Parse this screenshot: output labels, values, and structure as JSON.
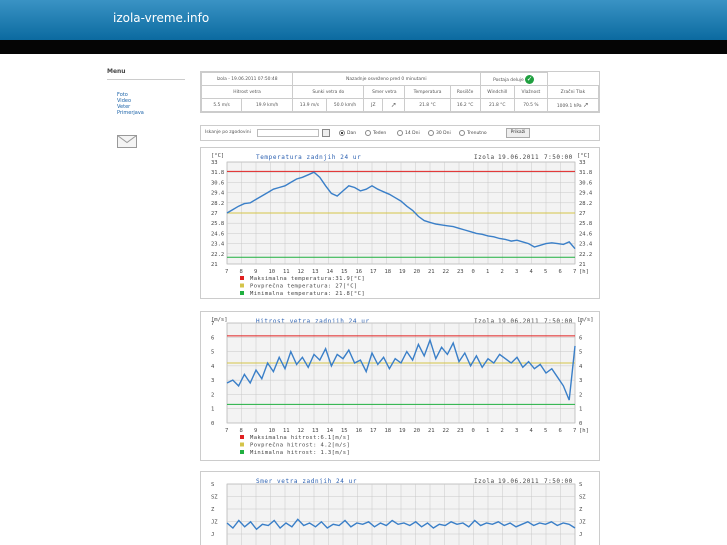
{
  "header": {
    "title": "izola-vreme.info"
  },
  "sidebar": {
    "menu_title": "Menu",
    "links": [
      "Foto",
      "Video",
      "Veter",
      "Primerjava"
    ]
  },
  "status": {
    "location_time": "Izola - 19.06.2011 07:50:48",
    "updated": "Nazadnje osveženo pred 0 minutami",
    "station_status": "Postaja deluje"
  },
  "table": {
    "headers": [
      "Hitrost vetra",
      "Sunki vetra do",
      "Smer vetra",
      "Temperatura",
      "Rosišče",
      "Windchill",
      "Vlažnost",
      "Zračni Tlak"
    ],
    "values": [
      "5.5 m/s",
      "19.9 km/h",
      "13.9 m/s",
      "50.0 km/h",
      "JZ",
      "21.8 °C",
      "16.2 °C",
      "21.8 °C",
      "70.5 %",
      "1009.1 hPa"
    ]
  },
  "search": {
    "label": "Iskanje po zgodovini",
    "radios": [
      "Dan",
      "Teden",
      "14 Dni",
      "30 Dni",
      "Trenutno"
    ],
    "selected": "Dan",
    "button": "Prikaži"
  },
  "chart_data": [
    {
      "type": "line",
      "title": "Temperatura zadnjih 24 ur",
      "station": "Izola",
      "date": "19.06.2011",
      "time": "7:50:00",
      "unit": "[°C]",
      "x_unit": "[h]",
      "x_ticks": [
        "7",
        "8",
        "9",
        "10",
        "11",
        "12",
        "13",
        "14",
        "15",
        "16",
        "17",
        "18",
        "19",
        "20",
        "21",
        "22",
        "23",
        "0",
        "1",
        "2",
        "3",
        "4",
        "5",
        "6",
        "7"
      ],
      "ylim": [
        21,
        33
      ],
      "y_ticks": [
        "21",
        "22.2",
        "23.4",
        "24.6",
        "25.8",
        "27",
        "28.2",
        "29.4",
        "30.6",
        "31.8",
        "33"
      ],
      "lines": {
        "max": 31.9,
        "avg": 27,
        "min": 21.8
      },
      "legend": [
        "Maksimalna temperatura:31.9[°C]",
        "Povprečna temperatura: 27[°C]",
        "Minimalna temperatura: 21.8[°C]"
      ],
      "series": [
        {
          "values": [
            27,
            27.4,
            27.8,
            28.1,
            28.2,
            28.6,
            29.0,
            29.4,
            29.8,
            30.0,
            30.2,
            30.6,
            31.0,
            31.2,
            31.5,
            31.8,
            31.2,
            30.2,
            29.3,
            29.0,
            29.6,
            30.2,
            30.0,
            29.6,
            29.8,
            30.2,
            29.8,
            29.5,
            29.2,
            28.8,
            28.4,
            27.8,
            27.3,
            26.6,
            26.1,
            25.9,
            25.7,
            25.6,
            25.5,
            25.4,
            25.2,
            25.0,
            24.8,
            24.6,
            24.5,
            24.3,
            24.2,
            24.0,
            23.9,
            23.7,
            23.8,
            23.6,
            23.4,
            23.0,
            23.2,
            23.4,
            23.5,
            23.4,
            23.3,
            23.6,
            22.8
          ]
        }
      ]
    },
    {
      "type": "line",
      "title": "Hitrost vetra zadnjih 24 ur",
      "station": "Izola",
      "date": "19.06.2011",
      "time": "7:50:00",
      "unit": "[m/s]",
      "x_unit": "[h]",
      "x_ticks": [
        "7",
        "8",
        "9",
        "10",
        "11",
        "12",
        "13",
        "14",
        "15",
        "16",
        "17",
        "18",
        "19",
        "20",
        "21",
        "22",
        "23",
        "0",
        "1",
        "2",
        "3",
        "4",
        "5",
        "6",
        "7"
      ],
      "ylim": [
        0,
        7
      ],
      "y_ticks": [
        "0",
        "1",
        "2",
        "3",
        "4",
        "5",
        "6",
        "7"
      ],
      "lines": {
        "max": 6.1,
        "avg": 4.2,
        "min": 1.3
      },
      "legend": [
        "Maksimalna hitrost:6.1[m/s]",
        "Povprečna hitrost: 4.2[m/s]",
        "Minimalna hitrost: 1.3[m/s]"
      ],
      "series": [
        {
          "values": [
            2.8,
            3.0,
            2.6,
            3.4,
            2.8,
            3.7,
            3.1,
            4.2,
            3.6,
            4.6,
            3.8,
            5.0,
            4.1,
            4.6,
            3.9,
            4.8,
            4.4,
            5.2,
            4.0,
            4.8,
            4.5,
            5.1,
            4.2,
            4.4,
            3.6,
            4.9,
            4.1,
            4.6,
            3.8,
            4.5,
            4.2,
            5.0,
            4.4,
            5.5,
            4.7,
            5.8,
            4.5,
            5.3,
            4.8,
            5.6,
            4.3,
            4.9,
            4.0,
            4.7,
            3.9,
            4.5,
            4.2,
            4.8,
            4.5,
            4.2,
            4.6,
            3.9,
            4.3,
            3.8,
            4.1,
            3.5,
            3.8,
            3.2,
            2.6,
            1.6,
            5.4
          ]
        }
      ]
    },
    {
      "type": "line",
      "title": "Smer vetra zadnjih 24 ur",
      "station": "Izola",
      "date": "19.06.2011",
      "time": "7:50:00",
      "y_ticks": [
        "S",
        "SZ",
        "Z",
        "JZ",
        "J"
      ],
      "series": [
        {
          "values": [
            3.0,
            3.4,
            2.8,
            3.3,
            2.9,
            3.5,
            3.1,
            3.2,
            2.8,
            3.4,
            3.0,
            3.3,
            2.7,
            3.2,
            3.0,
            3.3,
            2.9,
            3.4,
            3.1,
            3.2,
            2.8,
            3.3,
            3.0,
            3.1,
            2.9,
            3.3,
            3.0,
            3.2,
            2.8,
            3.1,
            3.0,
            3.2,
            2.9,
            3.3,
            3.0,
            3.4,
            3.1,
            3.2,
            2.9,
            3.1,
            3.0,
            3.3,
            2.8,
            3.2,
            3.0,
            3.1,
            2.9,
            3.2,
            3.0,
            3.3,
            3.1,
            2.9,
            3.2,
            3.0,
            3.1,
            2.9,
            3.2,
            3.0,
            3.1,
            3.4
          ]
        }
      ]
    }
  ]
}
